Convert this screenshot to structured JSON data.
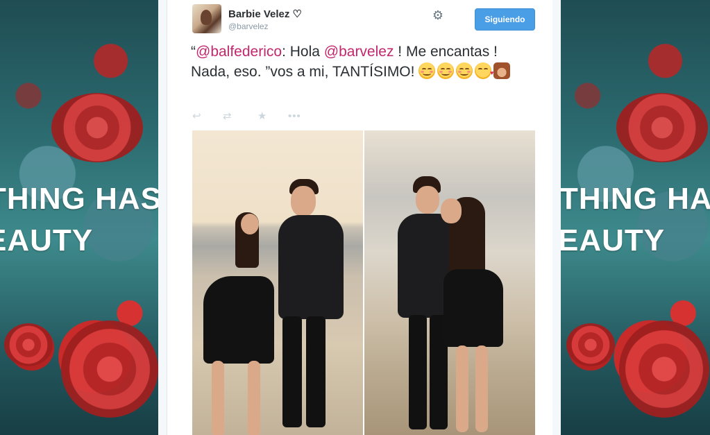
{
  "side_panel": {
    "line1": "THING HAS",
    "line2": "EAUTY"
  },
  "tweet": {
    "user": {
      "name": "Barbie Velez ♡",
      "handle": "@barvelez",
      "avatar_icon": "profile-photo"
    },
    "settings_icon": "gear-icon",
    "follow_label": "Siguiendo",
    "text": {
      "open_quote": "“",
      "mention1": "@balfederico",
      "part1": ": Hola ",
      "mention2": "@barvelez",
      "part2": " ! Me encantas ! Nada, eso. ”vos a mi, TANTÍSIMO! "
    },
    "emojis": [
      "smiling-face",
      "smiling-face",
      "smiling-face",
      "kissing-face",
      "see-no-evil-monkey"
    ],
    "actions": {
      "reply_icon": "↩",
      "retweet_icon": "⇄",
      "favorite_icon": "★",
      "more_icon": "•••"
    }
  },
  "colors": {
    "mention": "#c2276c",
    "follow_button": "#4a9ee6",
    "action_icons": "#ccd6dd"
  }
}
